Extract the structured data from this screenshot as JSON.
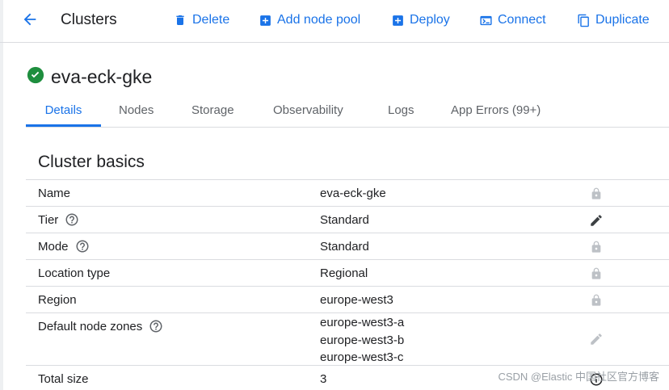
{
  "toolbar": {
    "title": "Clusters",
    "actions": [
      {
        "label": "Delete",
        "icon": "trash-icon"
      },
      {
        "label": "Add node pool",
        "icon": "add-box-icon"
      },
      {
        "label": "Deploy",
        "icon": "add-box-icon"
      },
      {
        "label": "Connect",
        "icon": "terminal-icon"
      },
      {
        "label": "Duplicate",
        "icon": "copy-icon"
      }
    ]
  },
  "cluster": {
    "name": "eva-eck-gke",
    "status_icon": "check-circle-icon",
    "status_color": "#1e8e3e"
  },
  "tabs": [
    {
      "label": "Details",
      "active": true
    },
    {
      "label": "Nodes"
    },
    {
      "label": "Storage"
    },
    {
      "label": "Observability"
    },
    {
      "label": "Logs"
    },
    {
      "label": "App Errors (99+)"
    }
  ],
  "section": {
    "title": "Cluster basics"
  },
  "rows": [
    {
      "label": "Name",
      "value": "eva-eck-gke",
      "icon": "lock-icon"
    },
    {
      "label": "Tier",
      "value": "Standard",
      "icon": "edit-icon",
      "help": true
    },
    {
      "label": "Mode",
      "value": "Standard",
      "icon": "lock-icon",
      "help": true
    },
    {
      "label": "Location type",
      "value": "Regional",
      "icon": "lock-icon"
    },
    {
      "label": "Region",
      "value": "europe-west3",
      "icon": "lock-icon"
    },
    {
      "label": "Default node zones",
      "values": [
        "europe-west3-a",
        "europe-west3-b",
        "europe-west3-c"
      ],
      "icon": "edit-icon-disabled",
      "help": true
    },
    {
      "label": "Total size",
      "value": "3",
      "icon": "info-icon"
    }
  ],
  "watermark": "CSDN @Elastic 中国社区官方博客",
  "colors": {
    "accent": "#1a73e8",
    "text": "#202124",
    "muted": "#5f6368",
    "icon_disabled": "#bdc1c6",
    "divider": "#dadce0"
  }
}
